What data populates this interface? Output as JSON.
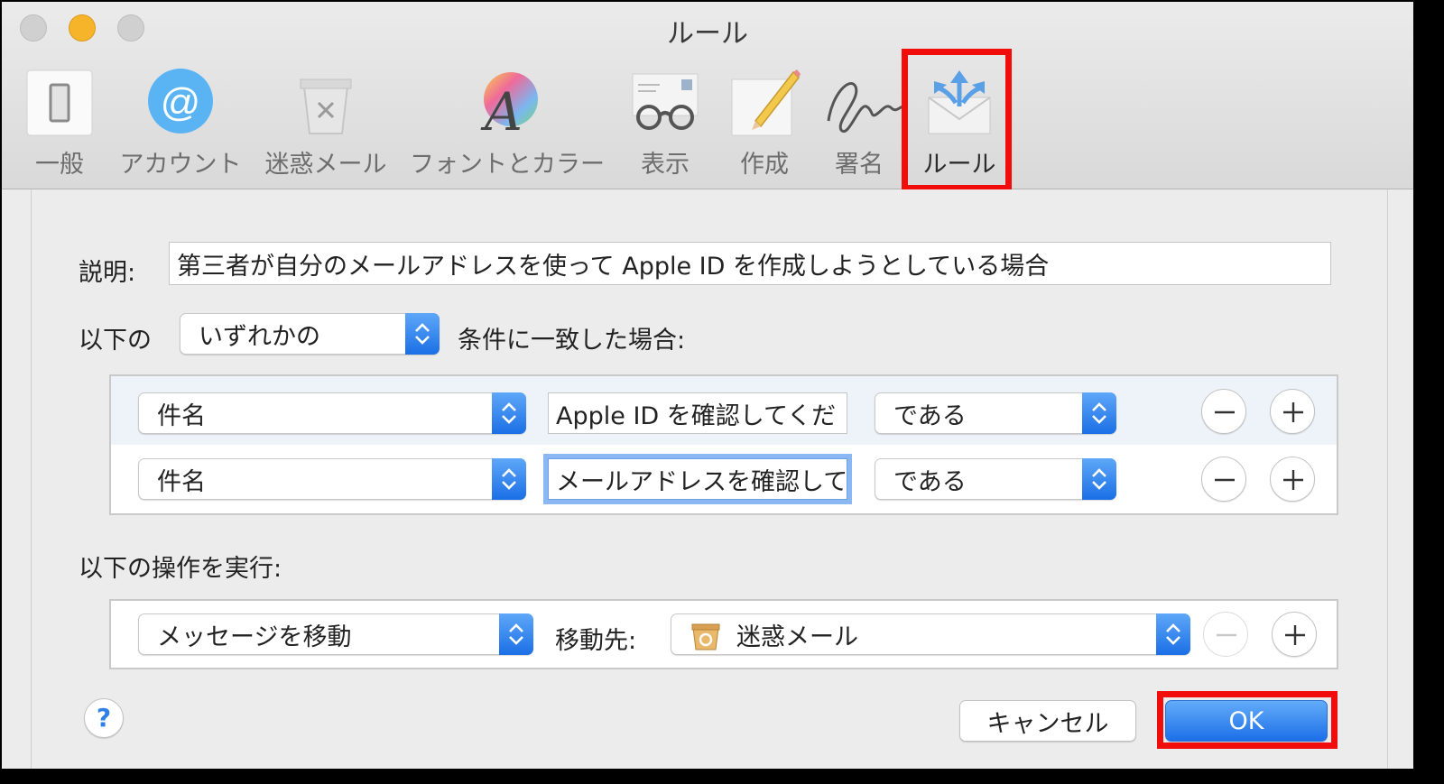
{
  "window": {
    "title": "ルール"
  },
  "toolbar": {
    "tabs": [
      {
        "label": "一般",
        "icon": "general-switch-icon"
      },
      {
        "label": "アカウント",
        "icon": "at-icon"
      },
      {
        "label": "迷惑メール",
        "icon": "junk-bin-icon"
      },
      {
        "label": "フォントとカラー",
        "icon": "font-color-icon"
      },
      {
        "label": "表示",
        "icon": "glasses-icon"
      },
      {
        "label": "作成",
        "icon": "pencil-note-icon"
      },
      {
        "label": "署名",
        "icon": "signature-icon"
      },
      {
        "label": "ルール",
        "icon": "rules-envelope-icon"
      }
    ],
    "active_tab": "ルール"
  },
  "form": {
    "description_label": "説明:",
    "description_value": "第三者が自分のメールアドレスを使って Apple ID を作成しようとしている場合",
    "match_prefix": "以下の",
    "match_mode": "いずれかの",
    "match_suffix": "条件に一致した場合:",
    "conditions": [
      {
        "field": "件名",
        "value": "Apple ID を確認してくだ",
        "operator": "である"
      },
      {
        "field": "件名",
        "value": "メールアドレスを確認して",
        "operator": "である"
      }
    ],
    "actions_label": "以下の操作を実行:",
    "action": {
      "type": "メッセージを移動",
      "destination_label": "移動先:",
      "destination": "迷惑メール"
    }
  },
  "buttons": {
    "help": "?",
    "cancel": "キャンセル",
    "ok": "OK"
  },
  "colors": {
    "highlight": "#f20d0d",
    "accent": "#1c6fe8"
  }
}
